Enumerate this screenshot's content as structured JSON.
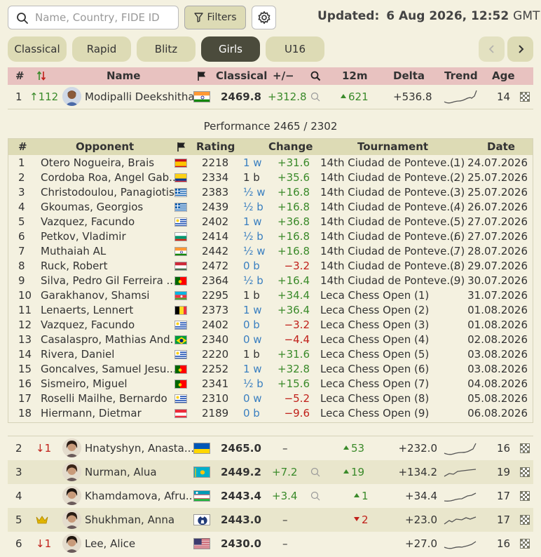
{
  "search": {
    "placeholder": "Name, Country, FIDE ID",
    "value": ""
  },
  "toolbar": {
    "filters_label": "Filters"
  },
  "updated": {
    "label": "Updated:",
    "date": "6 Aug 2026,",
    "time": "12:52",
    "tz": "GMT"
  },
  "tabs": [
    {
      "label": "Classical",
      "active": false
    },
    {
      "label": "Rapid",
      "active": false
    },
    {
      "label": "Blitz",
      "active": false
    },
    {
      "label": "Girls",
      "active": true
    },
    {
      "label": "U16",
      "active": false
    }
  ],
  "colors": {
    "accent": "#4b4b3c",
    "header_bg": "#e8c2c0",
    "tab_bg": "#dddbb5",
    "up": "#3a8a2a",
    "down": "#c0201a",
    "page_bg": "#f4f1e0"
  },
  "main_header": {
    "rank": "#",
    "change_icon": "sort-arrows-icon",
    "name": "Name",
    "flag_icon": "flag-icon",
    "classical": "Classical",
    "plusminus": "+/−",
    "search_icon": "search-icon",
    "m12": "12m",
    "delta": "Delta",
    "trend": "Trend",
    "age": "Age"
  },
  "top_player": {
    "rank": "1",
    "rank_change": "↑112",
    "name": "Modipalli Deekshitha",
    "country": "IND",
    "rating": "2469.8",
    "plusminus": "+312.8",
    "m12": "621",
    "delta": "+536.8",
    "age": "14"
  },
  "performance": "Performance 2465 / 2302",
  "opp_header": {
    "num": "#",
    "opponent": "Opponent",
    "rating": "Rating",
    "change": "Change",
    "tournament": "Tournament",
    "date": "Date"
  },
  "opponents": [
    {
      "num": "1",
      "name": "Otero Nogueira, Brais",
      "flag": "ESP",
      "rating": "2218",
      "result": "1 w",
      "change": "+31.6",
      "tournament": "14th Ciudad de Ponteve...",
      "round": "(1)",
      "date": "24.07.2026"
    },
    {
      "num": "2",
      "name": "Cordoba Roa, Angel Gab...",
      "flag": "COL",
      "rating": "2334",
      "result": "1 b",
      "change": "+35.6",
      "tournament": "14th Ciudad de Ponteve...",
      "round": "(2)",
      "date": "25.07.2026"
    },
    {
      "num": "3",
      "name": "Christodoulou, Panagiotis",
      "flag": "GRE",
      "rating": "2383",
      "result": "½ w",
      "change": "+16.8",
      "tournament": "14th Ciudad de Ponteve...",
      "round": "(3)",
      "date": "25.07.2026"
    },
    {
      "num": "4",
      "name": "Gkoumas, Georgios",
      "flag": "GRE",
      "rating": "2439",
      "result": "½ b",
      "change": "+16.8",
      "tournament": "14th Ciudad de Ponteve...",
      "round": "(4)",
      "date": "26.07.2026"
    },
    {
      "num": "5",
      "name": "Vazquez, Facundo",
      "flag": "URU",
      "rating": "2402",
      "result": "1 w",
      "change": "+36.8",
      "tournament": "14th Ciudad de Ponteve...",
      "round": "(5)",
      "date": "27.07.2026"
    },
    {
      "num": "6",
      "name": "Petkov, Vladimir",
      "flag": "BUL",
      "rating": "2414",
      "result": "½ b",
      "change": "+16.8",
      "tournament": "14th Ciudad de Ponteve...",
      "round": "(6)",
      "date": "27.07.2026"
    },
    {
      "num": "7",
      "name": "Muthaiah AL",
      "flag": "IND",
      "rating": "2442",
      "result": "½ w",
      "change": "+16.8",
      "tournament": "14th Ciudad de Ponteve...",
      "round": "(7)",
      "date": "28.07.2026"
    },
    {
      "num": "8",
      "name": "Ruck, Robert",
      "flag": "HUN",
      "rating": "2472",
      "result": "0 b",
      "change": "−3.2",
      "tournament": "14th Ciudad de Ponteve...",
      "round": "(8)",
      "date": "29.07.2026"
    },
    {
      "num": "9",
      "name": "Silva, Pedro Gil Ferreira ...",
      "flag": "POR",
      "rating": "2364",
      "result": "½ b",
      "change": "+16.4",
      "tournament": "14th Ciudad de Ponteve...",
      "round": "(9)",
      "date": "30.07.2026"
    },
    {
      "num": "10",
      "name": "Garakhanov, Shamsi",
      "flag": "AZE",
      "rating": "2295",
      "result": "1 b",
      "change": "+34.4",
      "tournament": "Leca Chess Open (1)",
      "round": "",
      "date": "31.07.2026"
    },
    {
      "num": "11",
      "name": "Lenaerts, Lennert",
      "flag": "BEL",
      "rating": "2373",
      "result": "1 w",
      "change": "+36.4",
      "tournament": "Leca Chess Open (2)",
      "round": "",
      "date": "01.08.2026"
    },
    {
      "num": "12",
      "name": "Vazquez, Facundo",
      "flag": "URU",
      "rating": "2402",
      "result": "0 b",
      "change": "−3.2",
      "tournament": "Leca Chess Open (3)",
      "round": "",
      "date": "01.08.2026"
    },
    {
      "num": "13",
      "name": "Casalaspro, Mathias And...",
      "flag": "BRA",
      "rating": "2340",
      "result": "0 w",
      "change": "−4.4",
      "tournament": "Leca Chess Open (4)",
      "round": "",
      "date": "02.08.2026"
    },
    {
      "num": "14",
      "name": "Rivera, Daniel",
      "flag": "URU",
      "rating": "2220",
      "result": "1 b",
      "change": "+31.6",
      "tournament": "Leca Chess Open (5)",
      "round": "",
      "date": "03.08.2026"
    },
    {
      "num": "15",
      "name": "Goncalves, Samuel Jesu...",
      "flag": "POR",
      "rating": "2252",
      "result": "1 w",
      "change": "+32.8",
      "tournament": "Leca Chess Open (6)",
      "round": "",
      "date": "03.08.2026"
    },
    {
      "num": "16",
      "name": "Sismeiro, Miguel",
      "flag": "POR",
      "rating": "2341",
      "result": "½ b",
      "change": "+15.6",
      "tournament": "Leca Chess Open (7)",
      "round": "",
      "date": "04.08.2026"
    },
    {
      "num": "17",
      "name": "Roselli Mailhe, Bernardo",
      "flag": "URU",
      "rating": "2310",
      "result": "0 w",
      "change": "−5.2",
      "tournament": "Leca Chess Open (8)",
      "round": "",
      "date": "05.08.2026"
    },
    {
      "num": "18",
      "name": "Hiermann, Dietmar",
      "flag": "AUT",
      "rating": "2189",
      "result": "0 b",
      "change": "−9.6",
      "tournament": "Leca Chess Open (9)",
      "round": "",
      "date": "06.08.2026"
    }
  ],
  "players": [
    {
      "rank": "2",
      "rank_change": "↓1",
      "rank_dir": "down",
      "crown": false,
      "name": "Hnatyshyn, Anasta...",
      "flag": "UKR",
      "rating": "2465.0",
      "plusminus": "–",
      "has_search": false,
      "m12": "53",
      "m12_dir": "up",
      "delta": "+232.0",
      "age": "16"
    },
    {
      "rank": "3",
      "rank_change": "",
      "rank_dir": "",
      "crown": false,
      "name": "Nurman, Alua",
      "flag": "KAZ",
      "rating": "2449.2",
      "plusminus": "+7.2",
      "has_search": true,
      "m12": "19",
      "m12_dir": "up",
      "delta": "+134.2",
      "age": "19"
    },
    {
      "rank": "4",
      "rank_change": "",
      "rank_dir": "",
      "crown": false,
      "name": "Khamdamova, Afru...",
      "flag": "UZB",
      "rating": "2443.4",
      "plusminus": "+3.4",
      "has_search": true,
      "m12": "1",
      "m12_dir": "up",
      "delta": "+34.4",
      "age": "17"
    },
    {
      "rank": "5",
      "rank_change": "",
      "rank_dir": "",
      "crown": true,
      "name": "Shukhman, Anna",
      "flag": "FID",
      "rating": "2443.0",
      "plusminus": "–",
      "has_search": false,
      "m12": "2",
      "m12_dir": "down",
      "delta": "+23.0",
      "age": "17"
    },
    {
      "rank": "6",
      "rank_change": "↓1",
      "rank_dir": "down",
      "crown": false,
      "name": "Lee, Alice",
      "flag": "USA",
      "rating": "2430.0",
      "plusminus": "–",
      "has_search": false,
      "m12": "",
      "m12_dir": "",
      "delta": "+27.0",
      "age": "16"
    }
  ]
}
